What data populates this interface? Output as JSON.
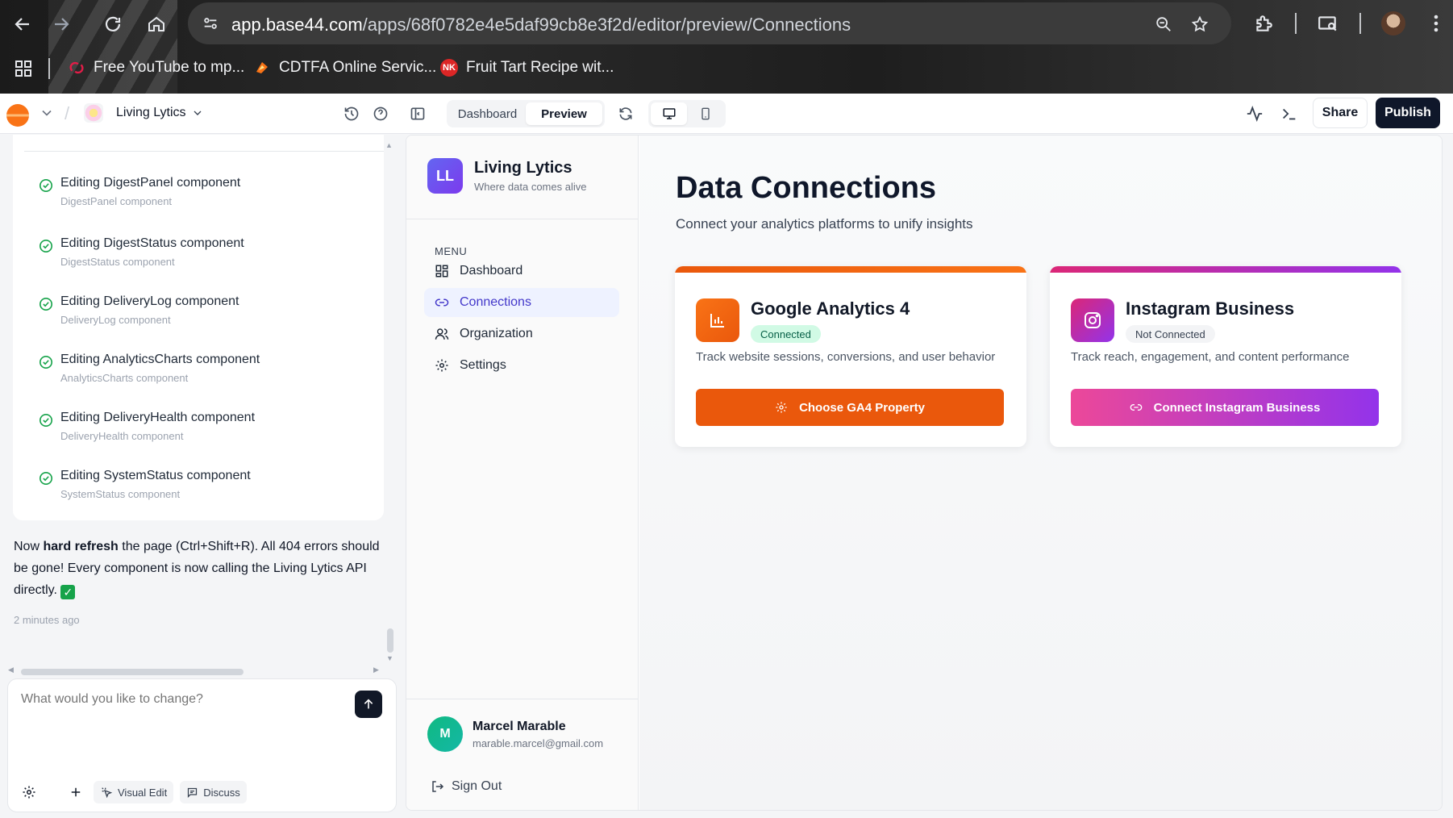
{
  "browser": {
    "url_host": "app.base44.com",
    "url_path": "/apps/68f0782e4e5daf99cb8e3f2d/editor/preview/Connections",
    "bookmarks": [
      {
        "label": "Free YouTube to mp...",
        "icon": "youtube-converter-icon",
        "color": "#e11d48"
      },
      {
        "label": "CDTFA Online Servic...",
        "icon": "cdtfa-icon",
        "color": "#f97316"
      },
      {
        "label": "Fruit Tart Recipe wit...",
        "icon": "nk-icon",
        "badge": "NK",
        "color": "#dc2626"
      }
    ]
  },
  "appbar": {
    "project_name": "Living Lytics",
    "tabs": [
      {
        "label": "Dashboard",
        "active": false
      },
      {
        "label": "Preview",
        "active": true
      }
    ],
    "share_label": "Share",
    "publish_label": "Publish"
  },
  "chat": {
    "items": [
      {
        "title": "Editing DigestPanel component",
        "subtitle": "DigestPanel component"
      },
      {
        "title": "Editing DigestStatus component",
        "subtitle": "DigestStatus component"
      },
      {
        "title": "Editing DeliveryLog component",
        "subtitle": "DeliveryLog component"
      },
      {
        "title": "Editing AnalyticsCharts component",
        "subtitle": "AnalyticsCharts component"
      },
      {
        "title": "Editing DeliveryHealth component",
        "subtitle": "DeliveryHealth component"
      },
      {
        "title": "Editing SystemStatus component",
        "subtitle": "SystemStatus component"
      }
    ],
    "message_pre": "Now ",
    "message_bold": "hard refresh",
    "message_post": " the page (Ctrl+Shift+R). All 404 errors should be gone! Every component is now calling the Living Lytics API directly.",
    "message_time": "2 minutes ago",
    "composer_placeholder": "What would you like to change?",
    "visual_edit_label": "Visual Edit",
    "discuss_label": "Discuss"
  },
  "preview": {
    "brand": {
      "initials": "LL",
      "name": "Living Lytics",
      "tagline": "Where data comes alive"
    },
    "menu_label": "MENU",
    "menu": [
      {
        "label": "Dashboard",
        "icon": "dashboard-icon",
        "active": false
      },
      {
        "label": "Connections",
        "icon": "link-icon",
        "active": true
      },
      {
        "label": "Organization",
        "icon": "users-icon",
        "active": false
      },
      {
        "label": "Settings",
        "icon": "settings-icon",
        "active": false
      }
    ],
    "user": {
      "initial": "M",
      "name": "Marcel Marable",
      "email": "marable.marcel@gmail.com"
    },
    "sign_out_label": "Sign Out",
    "title": "Data Connections",
    "subtitle": "Connect your analytics platforms to unify insights",
    "cards": [
      {
        "title": "Google Analytics 4",
        "status": "Connected",
        "description": "Track website sessions, conversions, and user behavior",
        "button_label": "Choose GA4 Property",
        "icon": "bar-chart-icon",
        "accent": "#ea580c"
      },
      {
        "title": "Instagram Business",
        "status": "Not Connected",
        "description": "Track reach, engagement, and content performance",
        "button_label": "Connect Instagram Business",
        "icon": "instagram-icon",
        "accent": "#c026d3"
      }
    ]
  }
}
